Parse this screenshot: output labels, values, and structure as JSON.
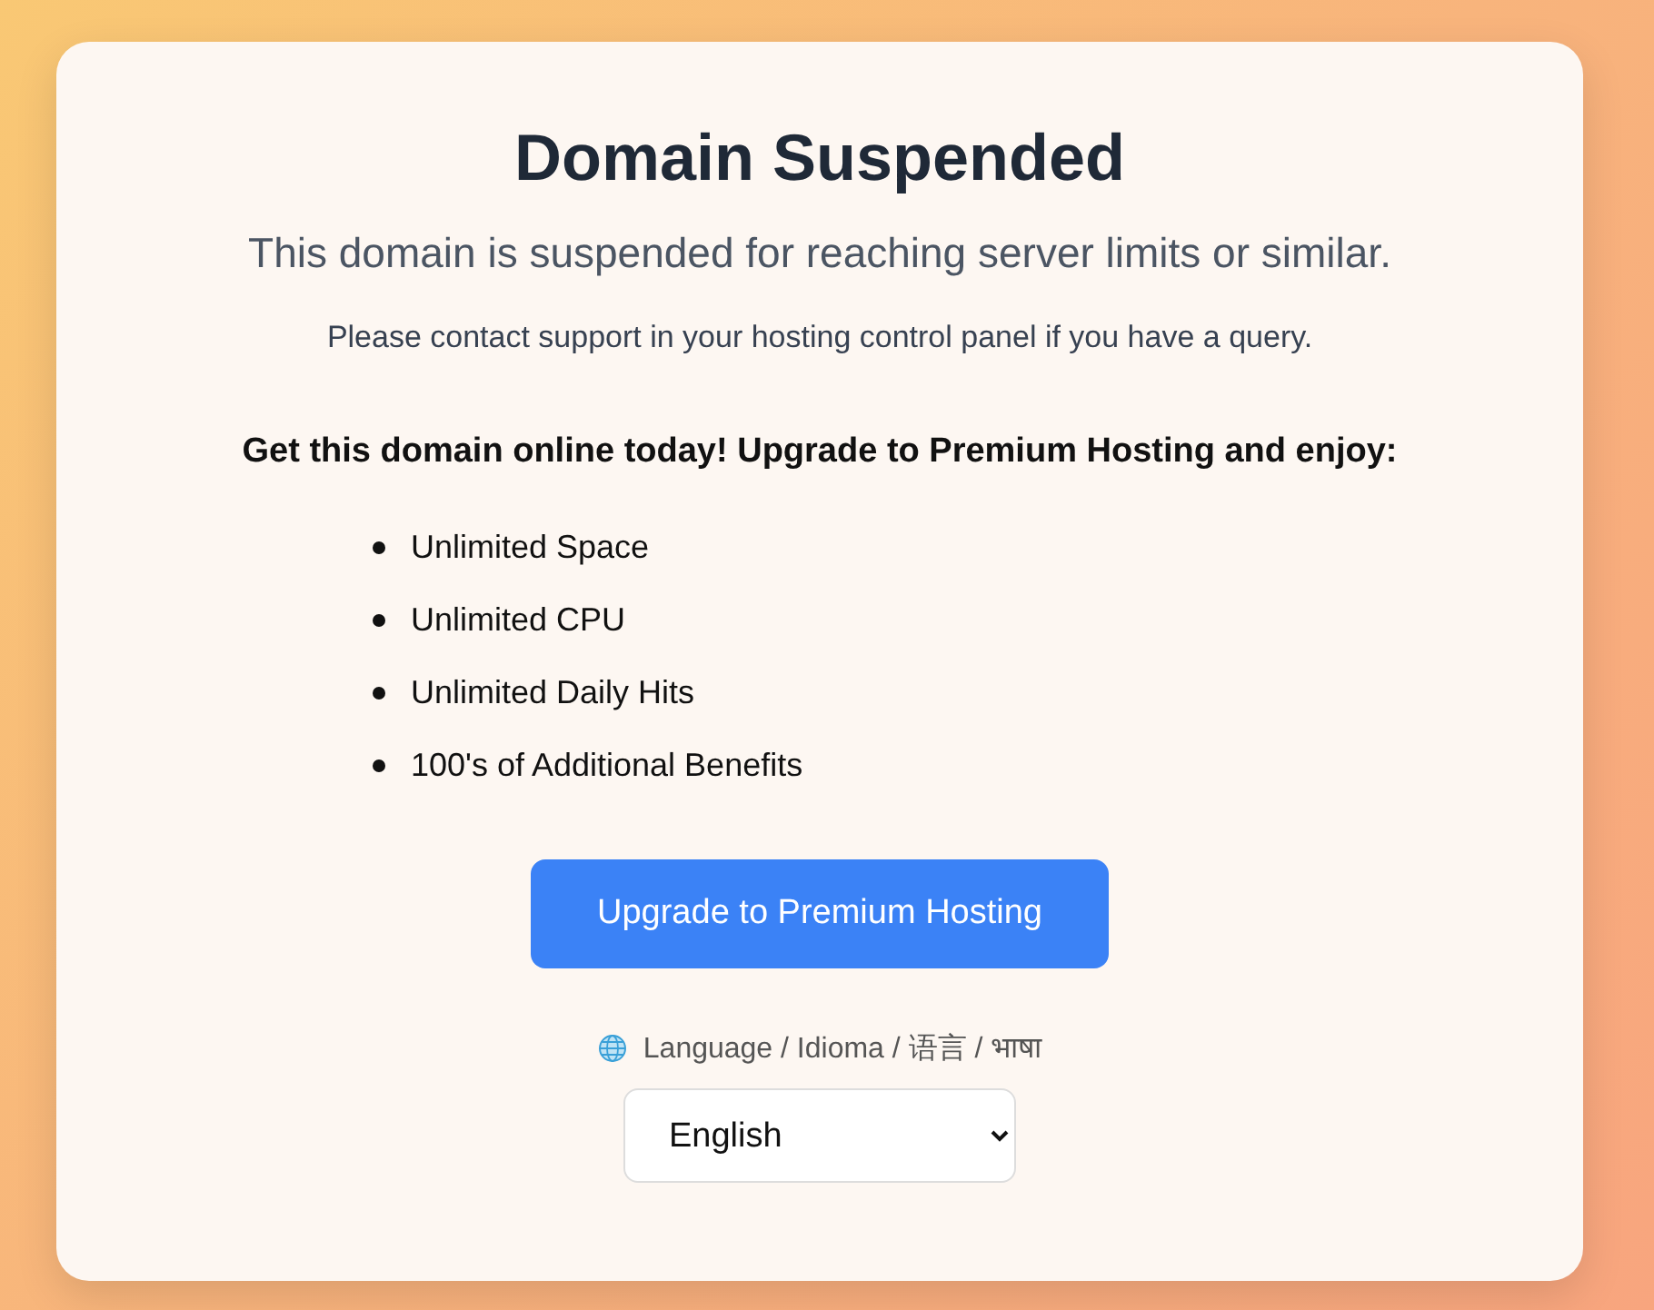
{
  "title": "Domain Suspended",
  "subtitle": "This domain is suspended for reaching server limits or similar.",
  "note": "Please contact support in your hosting control panel if you have a query.",
  "offer_heading": "Get this domain online today! Upgrade to Premium Hosting and enjoy:",
  "benefits": [
    "Unlimited Space",
    "Unlimited CPU",
    "Unlimited Daily Hits",
    "100's of Additional Benefits"
  ],
  "upgrade_button": "Upgrade to Premium Hosting",
  "language_label": "Language / Idioma / 语言 / भाषा",
  "language_select": {
    "value": "English"
  }
}
